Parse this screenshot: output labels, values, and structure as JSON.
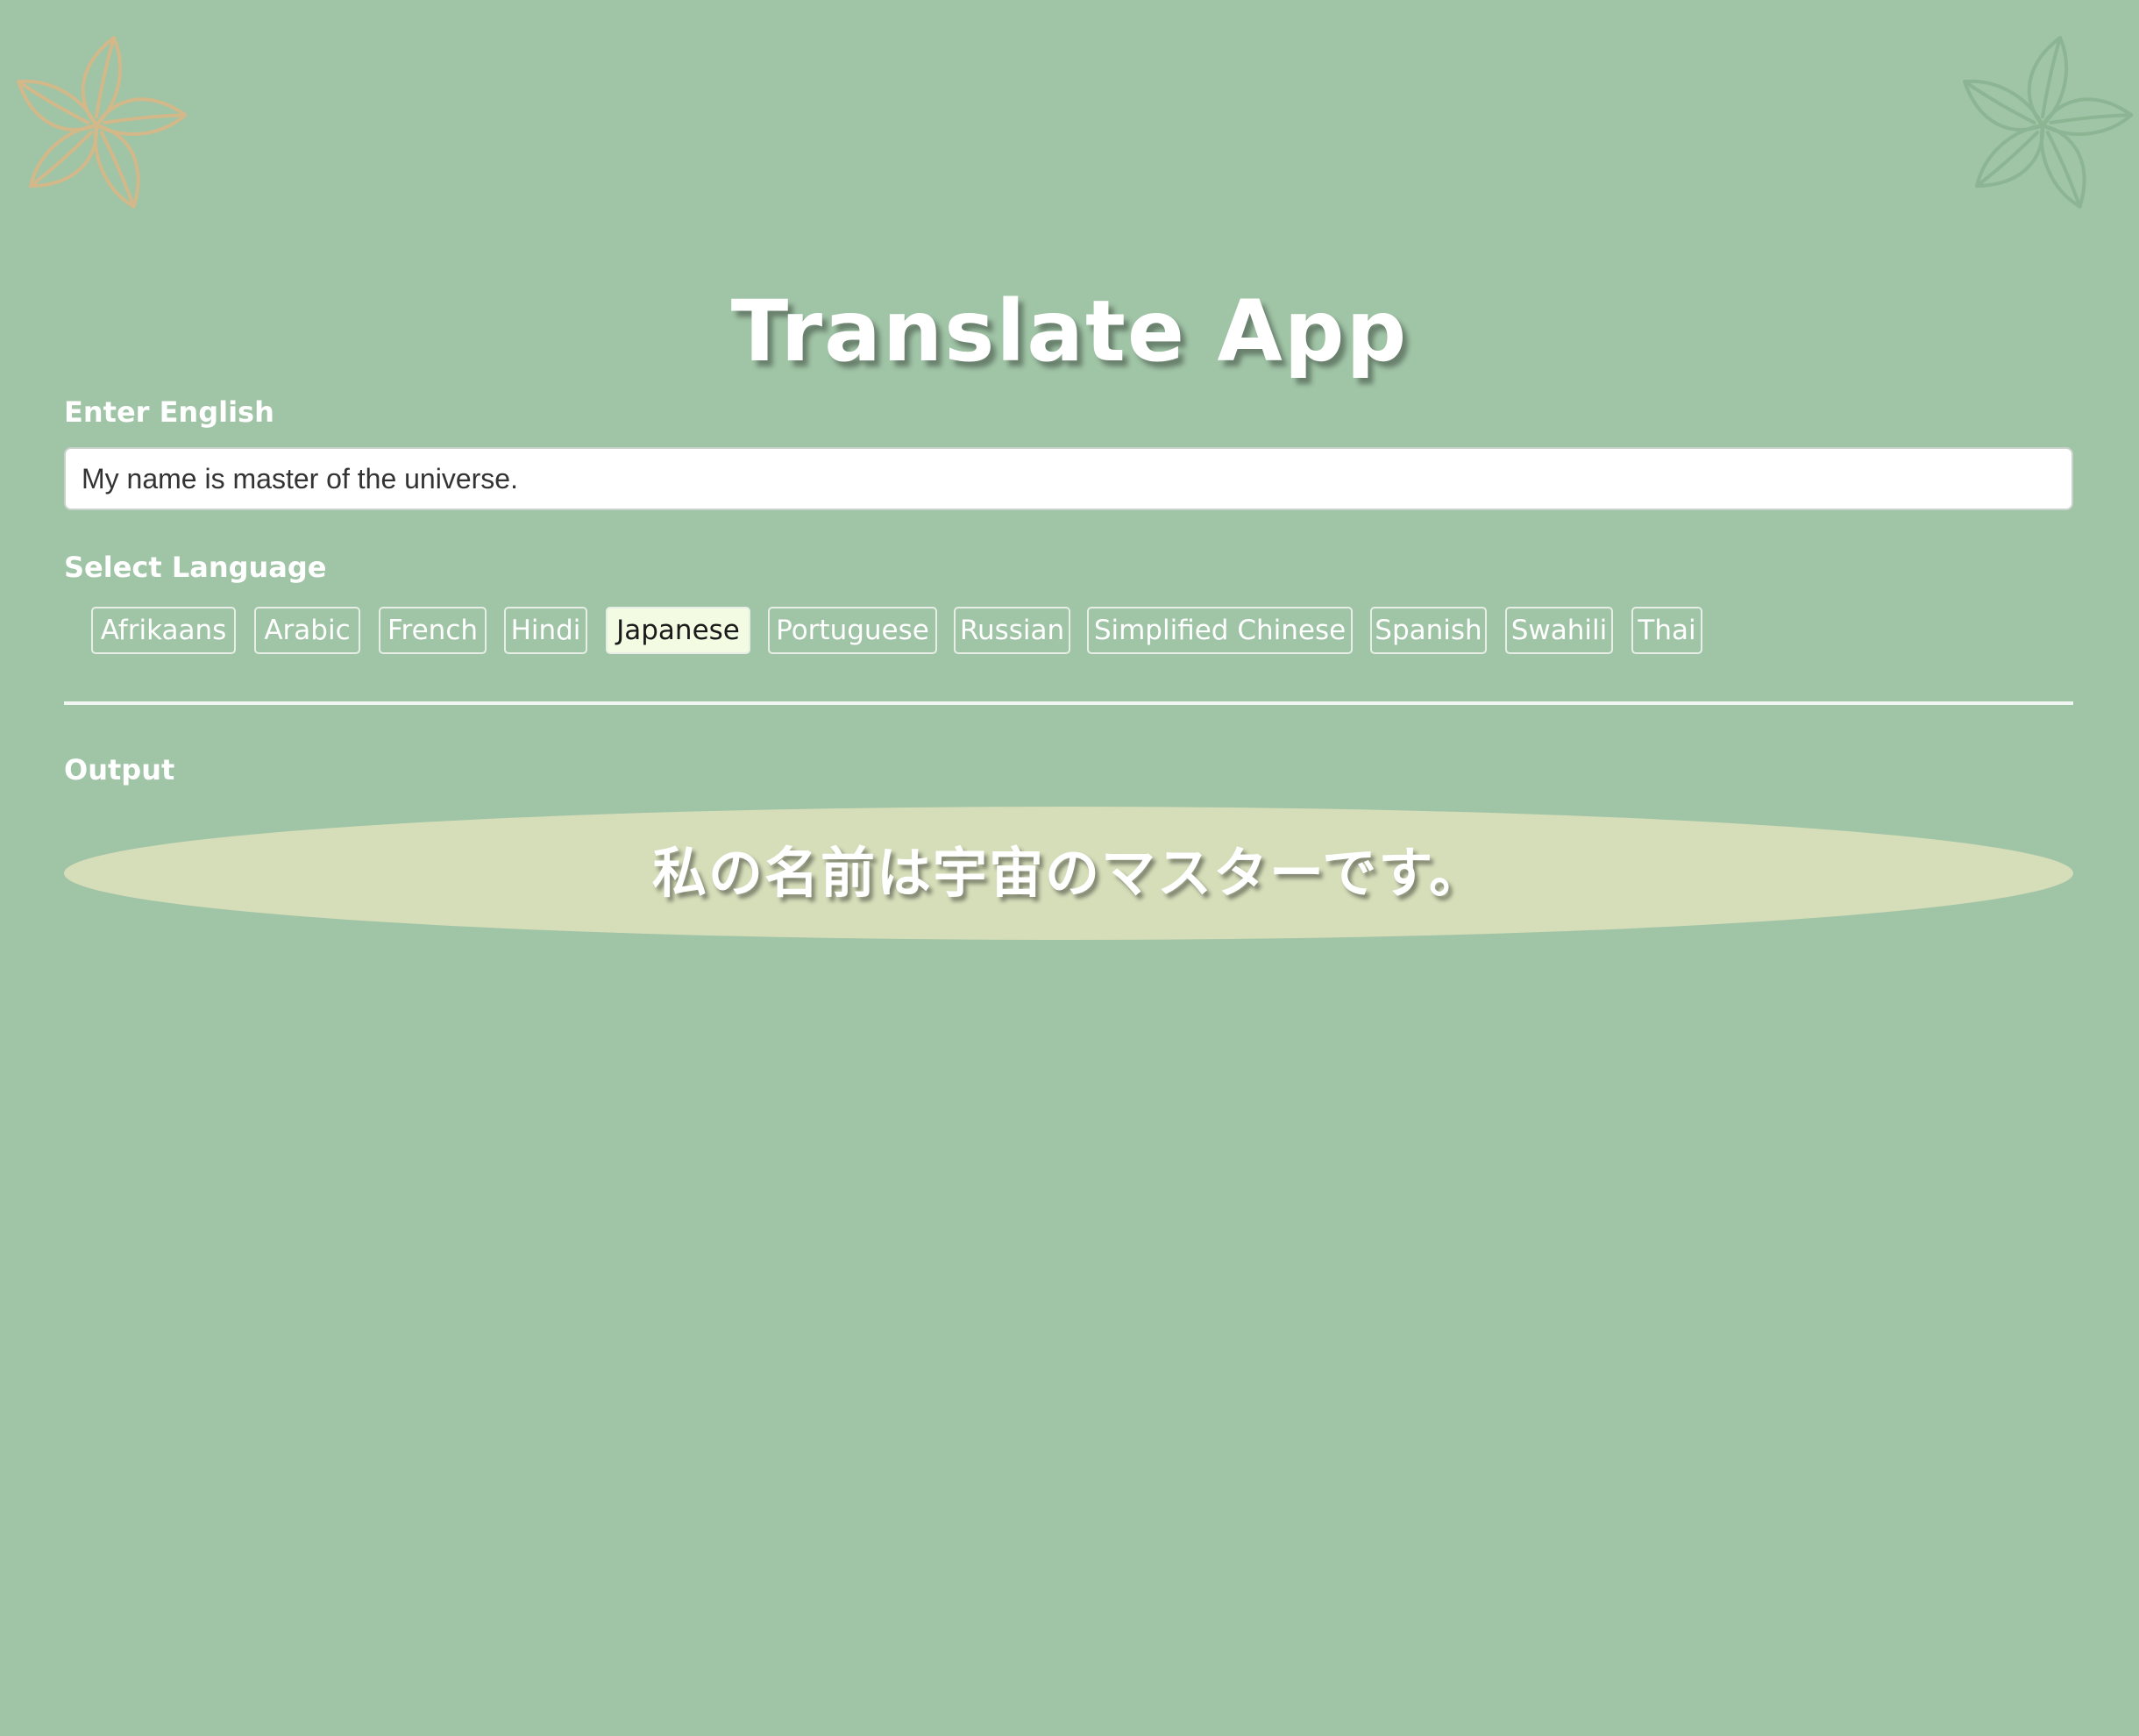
{
  "app": {
    "title": "Translate App"
  },
  "input": {
    "label": "Enter English",
    "value": "My name is master of the universe."
  },
  "languages": {
    "label": "Select Language",
    "selected": "Japanese",
    "options": [
      "Afrikaans",
      "Arabic",
      "French",
      "Hindi",
      "Japanese",
      "Portuguese",
      "Russian",
      "Simplified Chinese",
      "Spanish",
      "Swahili",
      "Thai"
    ]
  },
  "output": {
    "label": "Output",
    "text": "私の名前は宇宙のマスターです。"
  },
  "decorations": {
    "left_flower_icon": "flower-icon",
    "right_flower_icon": "flower-icon",
    "left_flower_color": "#d3b88a",
    "right_flower_color": "#8cb594"
  },
  "colors": {
    "background": "#a0c4a6",
    "output_background": "#d5ddb9",
    "selected_button": "#f3fbe2"
  }
}
